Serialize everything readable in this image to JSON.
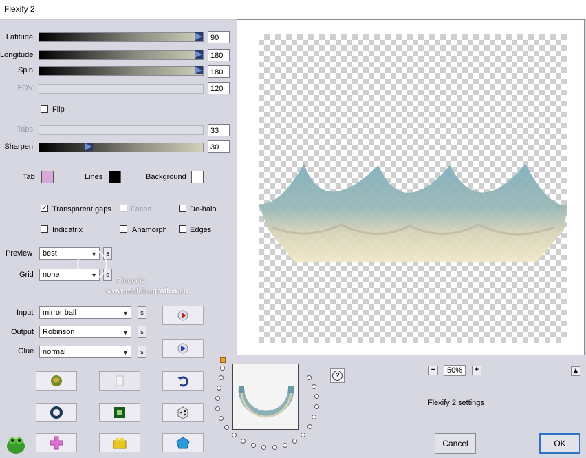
{
  "window": {
    "title": "Flexify 2"
  },
  "params": {
    "latitude": {
      "label": "Latitude",
      "value": "90",
      "level": 0.96
    },
    "longitude": {
      "label": "Longitude",
      "value": "180",
      "level": 0.96
    },
    "spin": {
      "label": "Spin",
      "value": "180",
      "level": 0.96
    },
    "fov": {
      "label": "FOV",
      "value": "120"
    },
    "tabs": {
      "label": "Tabs",
      "value": "33"
    },
    "sharpen": {
      "label": "Sharpen",
      "value": "30",
      "level": 0.3
    }
  },
  "flip": {
    "label": "Flip",
    "checked": false
  },
  "colors": {
    "tab": {
      "label": "Tab",
      "color": "#d8a8d8"
    },
    "lines": {
      "label": "Lines",
      "color": "#000000"
    },
    "background": {
      "label": "Background",
      "color": "#ffffff"
    }
  },
  "options": {
    "transparent_gaps": {
      "label": "Transparent gaps",
      "checked": true
    },
    "faces": {
      "label": "Faces",
      "checked": false
    },
    "de_halo": {
      "label": "De-halo",
      "checked": false
    },
    "indicatrix": {
      "label": "Indicatrix",
      "checked": false
    },
    "anamorph": {
      "label": "Anamorph",
      "checked": false
    },
    "edges": {
      "label": "Edges",
      "checked": false
    }
  },
  "selects": {
    "preview": {
      "label": "Preview",
      "value": "best"
    },
    "grid": {
      "label": "Grid",
      "value": "none"
    },
    "input": {
      "label": "Input",
      "value": "mirror ball"
    },
    "output": {
      "label": "Output",
      "value": "Robinson"
    },
    "glue": {
      "label": "Glue",
      "value": "normal"
    },
    "s_label": "s"
  },
  "watermark": {
    "name": "Pinuccia",
    "url": "www.maldiregrafica.eu"
  },
  "zoom": {
    "value": "50%",
    "minus": "−",
    "plus": "+"
  },
  "help_label": "?",
  "collapse_label": "▴",
  "settings_label": "Flexify 2 settings",
  "buttons": {
    "cancel": "Cancel",
    "ok": "OK"
  },
  "accent": "#2f74c8"
}
